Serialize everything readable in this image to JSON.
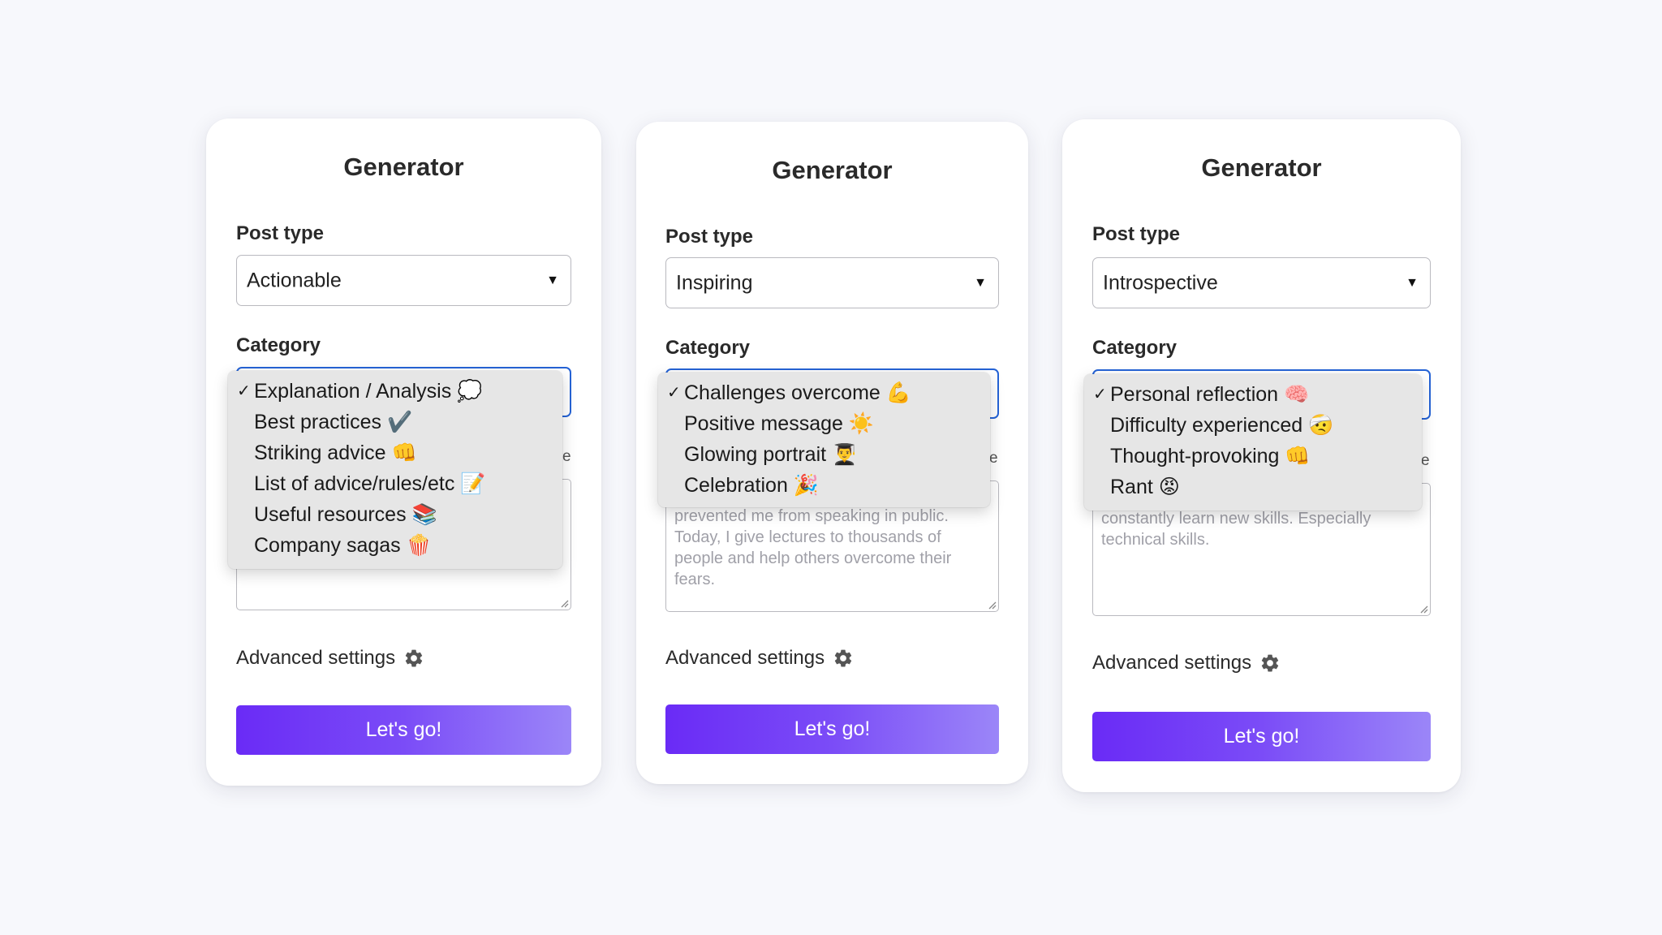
{
  "cards": [
    {
      "title": "Generator",
      "post_type_label": "Post type",
      "post_type_value": "Actionable",
      "category_label": "Category",
      "category_options": [
        {
          "label": "Explanation / Analysis 💭",
          "selected": true
        },
        {
          "label": "Best practices ✔️",
          "selected": false
        },
        {
          "label": "Striking advice 👊",
          "selected": false
        },
        {
          "label": "List of advice/rules/etc 📝",
          "selected": false
        },
        {
          "label": "Useful resources 📚",
          "selected": false
        },
        {
          "label": "Company sagas 🍿",
          "selected": false
        }
      ],
      "textarea_peek": "e",
      "textarea_placeholder": "",
      "advanced_label": "Advanced settings",
      "go_label": "Let's go!"
    },
    {
      "title": "Generator",
      "post_type_label": "Post type",
      "post_type_value": "Inspiring",
      "category_label": "Category",
      "category_options": [
        {
          "label": "Challenges overcome 💪",
          "selected": true
        },
        {
          "label": "Positive message ☀️",
          "selected": false
        },
        {
          "label": "Glowing portrait 👨‍🎓",
          "selected": false
        },
        {
          "label": "Celebration 🎉",
          "selected": false
        }
      ],
      "textarea_peek": "e",
      "textarea_placeholder": "prevented me from speaking in public. Today, I give lectures to thousands of people and help others overcome their fears.",
      "advanced_label": "Advanced settings",
      "go_label": "Let's go!"
    },
    {
      "title": "Generator",
      "post_type_label": "Post type",
      "post_type_value": "Introspective",
      "category_label": "Category",
      "category_options": [
        {
          "label": "Personal reflection 🧠",
          "selected": true
        },
        {
          "label": "Difficulty experienced 🤕",
          "selected": false
        },
        {
          "label": "Thought-provoking 👊",
          "selected": false
        },
        {
          "label": "Rant 😡",
          "selected": false
        }
      ],
      "textarea_peek": "e",
      "textarea_placeholder": "constantly learn new skills. Especially technical skills.",
      "advanced_label": "Advanced settings",
      "go_label": "Let's go!"
    }
  ],
  "colors": {
    "background": "#f7f8fc",
    "focus_border": "#2563d6",
    "button_gradient_start": "#6a2bf6",
    "button_gradient_end": "#9b86f8",
    "dropdown_bg": "#e6e6e6"
  },
  "icons": {
    "select_arrow": "caret-down-icon",
    "advanced": "gear-icon",
    "check": "checkmark-icon"
  }
}
